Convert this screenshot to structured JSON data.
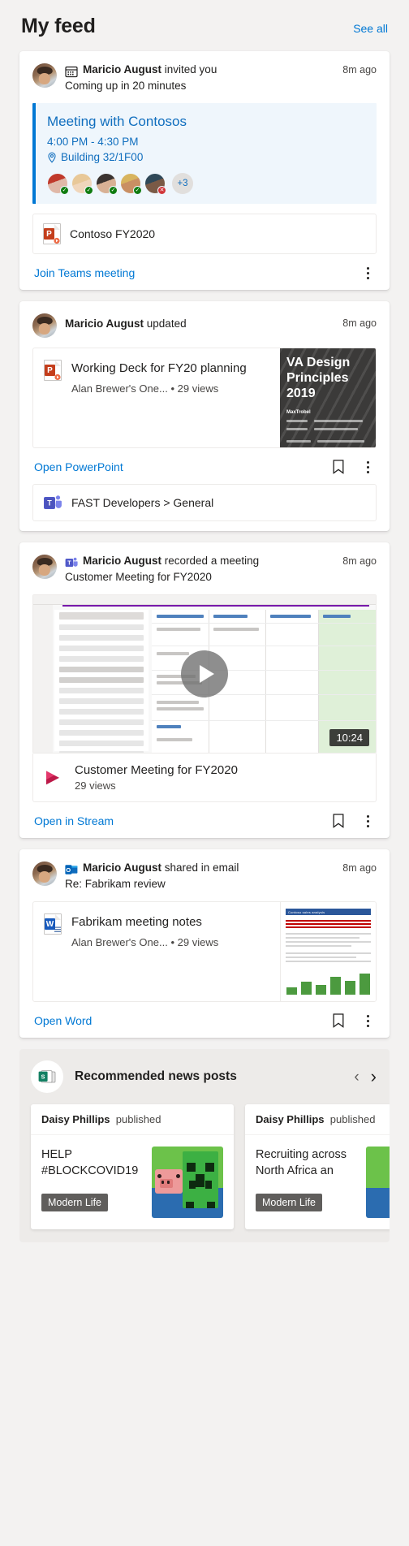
{
  "header": {
    "title": "My feed",
    "see_all": "See all"
  },
  "cards": [
    {
      "id": "meeting-invite",
      "actor": "Maricio August",
      "verb": "invited you",
      "subtitle": "Coming up in 20 minutes",
      "timestamp": "8m ago",
      "app_icon": "calendar-icon",
      "meeting": {
        "title": "Meeting with Contosos",
        "time": "4:00 PM - 4:30 PM",
        "location": "Building 32/1F00",
        "location_icon": "location-pin-icon",
        "attendees": [
          {
            "status": "accepted"
          },
          {
            "status": "accepted"
          },
          {
            "status": "accepted"
          },
          {
            "status": "accepted"
          },
          {
            "status": "declined"
          }
        ],
        "overflow_label": "+3"
      },
      "attachment": {
        "name": "Contoso FY2020",
        "icon": "powerpoint-file-icon"
      },
      "action_link": "Join Teams meeting",
      "more_icon": "more-options-icon"
    },
    {
      "id": "document-updated",
      "actor": "Maricio August",
      "verb": "updated",
      "timestamp": "8m ago",
      "document": {
        "title": "Working Deck for FY20 planning",
        "location": "Alan Brewer's One...",
        "separator": "•",
        "views": "29 views",
        "icon": "powerpoint-file-icon",
        "thumbnail_title": "VA Design Principles 2019",
        "thumbnail_author": "MaxTrobel"
      },
      "action_link": "Open PowerPoint",
      "save_icon": "bookmark-icon",
      "more_icon": "more-options-icon",
      "context_chip": {
        "name": "FAST Developers > General",
        "icon": "teams-icon"
      }
    },
    {
      "id": "meeting-recording",
      "actor": "Maricio August",
      "verb": "recorded a meeting",
      "subtitle": "Customer Meeting for FY2020",
      "timestamp": "8m ago",
      "app_icon": "teams-meeting-icon",
      "video": {
        "duration": "10:24",
        "play_icon": "play-button-icon",
        "title": "Customer Meeting for FY2020",
        "views": "29 views",
        "icon": "stream-icon"
      },
      "action_link": "Open in Stream",
      "save_icon": "bookmark-icon",
      "more_icon": "more-options-icon"
    },
    {
      "id": "email-share",
      "actor": "Maricio August",
      "verb": "shared in email",
      "subtitle": "Re: Fabrikam review",
      "timestamp": "8m ago",
      "app_icon": "outlook-icon",
      "document": {
        "title": "Fabrikam meeting notes",
        "location": "Alan Brewer's One...",
        "separator": "•",
        "views": "29 views",
        "icon": "word-file-icon",
        "thumbnail_title": "Contoso sales analysis"
      },
      "action_link": "Open Word",
      "save_icon": "bookmark-icon",
      "more_icon": "more-options-icon"
    }
  ],
  "news": {
    "title": "Recommended news posts",
    "badge_icon": "sharepoint-news-icon",
    "prev_icon": "chevron-left-icon",
    "next_icon": "chevron-right-icon",
    "prev_label": "‹",
    "next_label": "›",
    "posts": [
      {
        "author": "Daisy Phillips",
        "verb": "published",
        "title": "HELP #BLOCKCOVID19",
        "tag": "Modern Life",
        "thumbnail": "minecraft-creeper-image"
      },
      {
        "author": "Daisy Phillips",
        "verb": "published",
        "title": "Recruiting across North Africa an",
        "tag": "Modern Life",
        "thumbnail": "minecraft-creeper-image"
      }
    ]
  },
  "colors": {
    "accent": "#0078d4",
    "meeting_bg": "#eff6fc",
    "meeting_text": "#106ebe",
    "page_bg": "#f3f2f1",
    "accepted": "#107c10",
    "declined": "#d13438"
  }
}
